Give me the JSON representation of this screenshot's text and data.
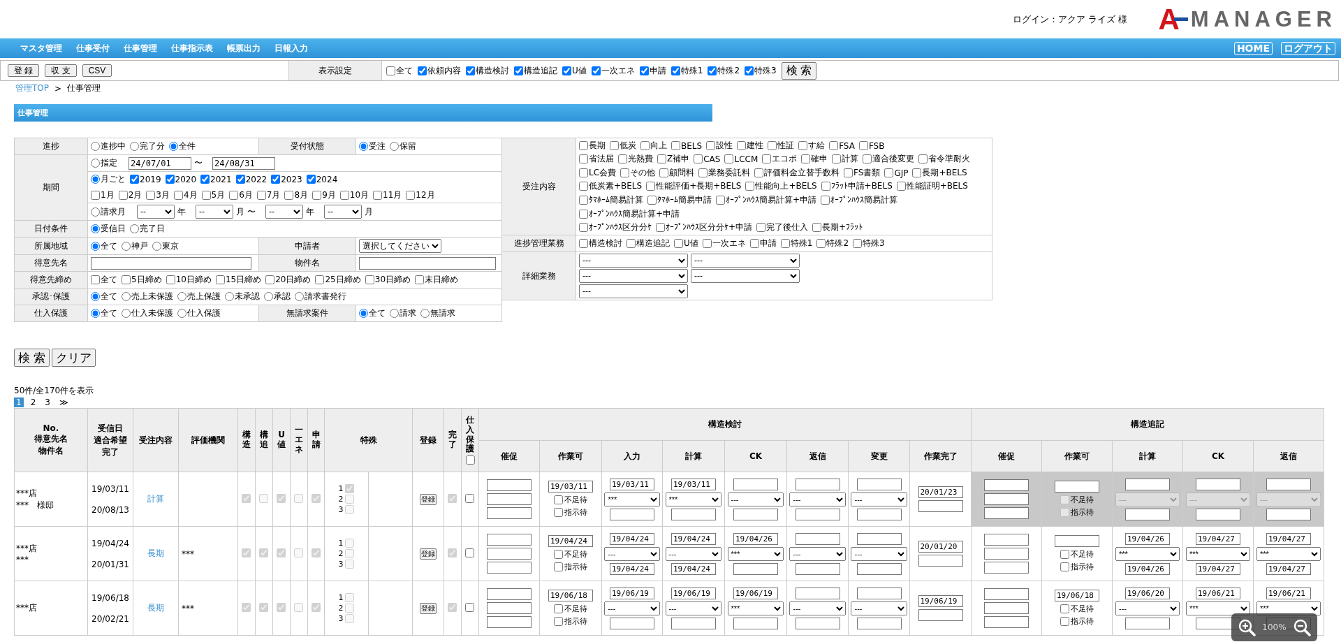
{
  "header": {
    "login": "ログイン：アクア ライズ 様",
    "logo": {
      "mark": "A",
      "name": "MANAGER"
    }
  },
  "nav": {
    "items": [
      "マスタ管理",
      "仕事受付",
      "仕事管理",
      "仕事指示表",
      "帳票出力",
      "日報入力"
    ],
    "buttons": [
      "HOME",
      "ログアウト"
    ]
  },
  "toolbar": {
    "buttons": [
      "登 録",
      "収 支",
      "CSV"
    ],
    "display_label": "表示設定",
    "display_options": [
      {
        "kind": "checkbox",
        "label": "全て",
        "checked": false
      },
      {
        "kind": "checkbox",
        "label": "依頼内容",
        "checked": true
      },
      {
        "kind": "checkbox",
        "label": "構造検討",
        "checked": true
      },
      {
        "kind": "checkbox",
        "label": "構造追記",
        "checked": true
      },
      {
        "kind": "checkbox",
        "label": "U値",
        "checked": true
      },
      {
        "kind": "checkbox",
        "label": "一次エネ",
        "checked": true
      },
      {
        "kind": "checkbox",
        "label": "申請",
        "checked": true
      },
      {
        "kind": "checkbox",
        "label": "特殊1",
        "checked": true
      },
      {
        "kind": "checkbox",
        "label": "特殊2",
        "checked": true
      },
      {
        "kind": "checkbox",
        "label": "特殊3",
        "checked": true
      }
    ],
    "search_button": "検 索"
  },
  "breadcrumb": {
    "link": "管理TOP",
    "separator": ">",
    "current": "仕事管理"
  },
  "section_title": "仕事管理",
  "filter_left": {
    "rows": [
      {
        "fields": [
          {
            "label": "進捗",
            "lines": [
              [
                {
                  "kind": "radio",
                  "label": "進捗中",
                  "selected": false
                },
                {
                  "kind": "radio",
                  "label": "完了分",
                  "selected": false
                },
                {
                  "kind": "radio",
                  "label": "全件",
                  "selected": true
                }
              ]
            ]
          },
          {
            "label": "受付状態",
            "lines": [
              [
                {
                  "kind": "radio",
                  "label": "受注",
                  "selected": true
                },
                {
                  "kind": "radio",
                  "label": "保留",
                  "selected": false
                }
              ]
            ]
          }
        ]
      },
      {
        "fields": [
          {
            "label": "期間",
            "lines": [
              [
                {
                  "kind": "radio",
                  "label": "指定",
                  "selected": false
                },
                {
                  "kind": "date",
                  "value": "24/07/01"
                },
                {
                  "kind": "text",
                  "text": "〜"
                },
                {
                  "kind": "date",
                  "value": "24/08/31"
                }
              ],
              [
                {
                  "kind": "radio",
                  "label": "月ごと",
                  "selected": true
                },
                {
                  "kind": "checkbox",
                  "label": "2019",
                  "checked": true
                },
                {
                  "kind": "checkbox",
                  "label": "2020",
                  "checked": true
                },
                {
                  "kind": "checkbox",
                  "label": "2021",
                  "checked": true
                },
                {
                  "kind": "checkbox",
                  "label": "2022",
                  "checked": true
                },
                {
                  "kind": "checkbox",
                  "label": "2023",
                  "checked": true
                },
                {
                  "kind": "checkbox",
                  "label": "2024",
                  "checked": true
                },
                {
                  "kind": "break"
                },
                {
                  "kind": "checkbox",
                  "label": "1月",
                  "checked": false
                },
                {
                  "kind": "checkbox",
                  "label": "2月",
                  "checked": false
                },
                {
                  "kind": "checkbox",
                  "label": "3月",
                  "checked": false
                },
                {
                  "kind": "checkbox",
                  "label": "4月",
                  "checked": false
                },
                {
                  "kind": "checkbox",
                  "label": "5月",
                  "checked": false
                },
                {
                  "kind": "checkbox",
                  "label": "6月",
                  "checked": false
                },
                {
                  "kind": "checkbox",
                  "label": "7月",
                  "checked": false
                },
                {
                  "kind": "checkbox",
                  "label": "8月",
                  "checked": false
                },
                {
                  "kind": "checkbox",
                  "label": "9月",
                  "checked": false
                },
                {
                  "kind": "checkbox",
                  "label": "10月",
                  "checked": false
                },
                {
                  "kind": "checkbox",
                  "label": "11月",
                  "checked": false
                },
                {
                  "kind": "checkbox",
                  "label": "12月",
                  "checked": false
                }
              ],
              [
                {
                  "kind": "radio",
                  "label": "請求月",
                  "selected": false
                },
                {
                  "kind": "period-select",
                  "value": "--"
                },
                {
                  "kind": "text",
                  "text": "年"
                },
                {
                  "kind": "period-select",
                  "value": "--"
                },
                {
                  "kind": "text",
                  "text": "月"
                },
                {
                  "kind": "text",
                  "text": "〜"
                },
                {
                  "kind": "period-select",
                  "value": "--"
                },
                {
                  "kind": "text",
                  "text": "年"
                },
                {
                  "kind": "period-select",
                  "value": "--"
                },
                {
                  "kind": "text",
                  "text": "月"
                }
              ]
            ]
          }
        ]
      },
      {
        "fields": [
          {
            "label": "日付条件",
            "lines": [
              [
                {
                  "kind": "radio",
                  "label": "受信日",
                  "selected": true
                },
                {
                  "kind": "radio",
                  "label": "完了日",
                  "selected": false
                }
              ]
            ]
          }
        ]
      },
      {
        "fields": [
          {
            "label": "所属地域",
            "lines": [
              [
                {
                  "kind": "radio",
                  "label": "全て",
                  "selected": true
                },
                {
                  "kind": "radio",
                  "label": "神戸",
                  "selected": false
                },
                {
                  "kind": "radio",
                  "label": "東京",
                  "selected": false
                }
              ]
            ]
          },
          {
            "label": "申請者",
            "lines": [
              [
                {
                  "kind": "select",
                  "value": "選択してください"
                }
              ]
            ]
          }
        ]
      },
      {
        "fields": [
          {
            "label": "得意先名",
            "lines": [
              [
                {
                  "kind": "input"
                }
              ]
            ]
          },
          {
            "label": "物件名",
            "lines": [
              [
                {
                  "kind": "input"
                }
              ]
            ]
          }
        ]
      },
      {
        "fields": [
          {
            "label": "得意先締め",
            "lines": [
              [
                {
                  "kind": "checkbox",
                  "label": "全て",
                  "checked": false
                },
                {
                  "kind": "checkbox",
                  "label": "5日締め",
                  "checked": false
                },
                {
                  "kind": "checkbox",
                  "label": "10日締め",
                  "checked": false
                },
                {
                  "kind": "checkbox",
                  "label": "15日締め",
                  "checked": false
                },
                {
                  "kind": "checkbox",
                  "label": "20日締め",
                  "checked": false
                },
                {
                  "kind": "checkbox",
                  "label": "25日締め",
                  "checked": false
                },
                {
                  "kind": "checkbox",
                  "label": "30日締め",
                  "checked": false
                },
                {
                  "kind": "checkbox",
                  "label": "末日締め",
                  "checked": false
                }
              ]
            ]
          }
        ]
      },
      {
        "fields": [
          {
            "label": "承認･保護",
            "lines": [
              [
                {
                  "kind": "radio",
                  "label": "全て",
                  "selected": true
                },
                {
                  "kind": "radio",
                  "label": "売上未保護",
                  "selected": false
                },
                {
                  "kind": "radio",
                  "label": "売上保護",
                  "selected": false
                },
                {
                  "kind": "radio",
                  "label": "未承認",
                  "selected": false
                },
                {
                  "kind": "radio",
                  "label": "承認",
                  "selected": false
                },
                {
                  "kind": "radio",
                  "label": "請求書発行",
                  "selected": false
                }
              ]
            ]
          }
        ]
      },
      {
        "fields": [
          {
            "label": "仕入保護",
            "lines": [
              [
                {
                  "kind": "radio",
                  "label": "全て",
                  "selected": true
                },
                {
                  "kind": "radio",
                  "label": "仕入未保護",
                  "selected": false
                },
                {
                  "kind": "radio",
                  "label": "仕入保護",
                  "selected": false
                }
              ]
            ]
          },
          {
            "label": "無請求案件",
            "lines": [
              [
                {
                  "kind": "radio",
                  "label": "全て",
                  "selected": true
                },
                {
                  "kind": "radio",
                  "label": "請求",
                  "selected": false
                },
                {
                  "kind": "radio",
                  "label": "無請求",
                  "selected": false
                }
              ]
            ]
          }
        ]
      }
    ]
  },
  "filter_right": {
    "rows": [
      {
        "fields": [
          {
            "label": "受注内容",
            "lines": [
              [
                {
                  "kind": "checkbox",
                  "label": "長期",
                  "checked": false
                },
                {
                  "kind": "checkbox",
                  "label": "低炭",
                  "checked": false
                },
                {
                  "kind": "checkbox",
                  "label": "向上",
                  "checked": false
                },
                {
                  "kind": "checkbox",
                  "label": "BELS",
                  "checked": false
                },
                {
                  "kind": "checkbox",
                  "label": "設性",
                  "checked": false
                },
                {
                  "kind": "checkbox",
                  "label": "建性",
                  "checked": false
                },
                {
                  "kind": "checkbox",
                  "label": "性証",
                  "checked": false
                },
                {
                  "kind": "checkbox",
                  "label": "す給",
                  "checked": false
                },
                {
                  "kind": "checkbox",
                  "label": "FSA",
                  "checked": false
                },
                {
                  "kind": "checkbox",
                  "label": "FSB",
                  "checked": false
                }
              ],
              [
                {
                  "kind": "checkbox",
                  "label": "省法届",
                  "checked": false
                },
                {
                  "kind": "checkbox",
                  "label": "光熱費",
                  "checked": false
                },
                {
                  "kind": "checkbox",
                  "label": "Z補申",
                  "checked": false
                },
                {
                  "kind": "checkbox",
                  "label": "CAS",
                  "checked": false
                },
                {
                  "kind": "checkbox",
                  "label": "LCCM",
                  "checked": false
                },
                {
                  "kind": "checkbox",
                  "label": "エコポ",
                  "checked": false
                },
                {
                  "kind": "checkbox",
                  "label": "確申",
                  "checked": false
                },
                {
                  "kind": "checkbox",
                  "label": "計算",
                  "checked": false
                },
                {
                  "kind": "checkbox",
                  "label": "適合後変更",
                  "checked": false
                },
                {
                  "kind": "checkbox",
                  "label": "省令準耐火",
                  "checked": false
                },
                {
                  "kind": "checkbox",
                  "label": "LC会費",
                  "checked": false
                },
                {
                  "kind": "checkbox",
                  "label": "その他",
                  "checked": false
                },
                {
                  "kind": "checkbox",
                  "label": "顧問料",
                  "checked": false
                },
                {
                  "kind": "checkbox",
                  "label": "業務委託料",
                  "checked": false
                },
                {
                  "kind": "checkbox",
                  "label": "評価料金立替手数料",
                  "checked": false
                },
                {
                  "kind": "checkbox",
                  "label": "FS書類",
                  "checked": false
                },
                {
                  "kind": "checkbox",
                  "label": "GJP",
                  "checked": false
                },
                {
                  "kind": "checkbox",
                  "label": "長期+BELS",
                  "checked": false
                }
              ],
              [
                {
                  "kind": "checkbox",
                  "label": "低炭素+BELS",
                  "checked": false
                },
                {
                  "kind": "checkbox",
                  "label": "性能評価+長期+BELS",
                  "checked": false
                },
                {
                  "kind": "checkbox",
                  "label": "性能向上+BELS",
                  "checked": false
                },
                {
                  "kind": "checkbox",
                  "label": "ﾌﾗｯﾄ申請+BELS",
                  "checked": false
                },
                {
                  "kind": "checkbox",
                  "label": "性能証明+BELS",
                  "checked": false
                },
                {
                  "kind": "checkbox",
                  "label": "ﾀﾏﾎｰﾑ簡易計算",
                  "checked": false
                },
                {
                  "kind": "checkbox",
                  "label": "ﾀﾏﾎｰﾑ簡易申請",
                  "checked": false
                },
                {
                  "kind": "checkbox",
                  "label": "ｵｰﾌﾟﾝﾊｳｽ簡易計算+申請",
                  "checked": false
                },
                {
                  "kind": "checkbox",
                  "label": "ｵｰﾌﾟﾝﾊｳｽ簡易計算",
                  "checked": false
                },
                {
                  "kind": "checkbox",
                  "label": "ｵｰﾌﾟﾝﾊｳｽ簡易計算+申請",
                  "checked": false
                }
              ],
              [
                {
                  "kind": "checkbox",
                  "label": "ｵｰﾌﾟﾝﾊｳｽ区分分ｹ",
                  "checked": false
                },
                {
                  "kind": "checkbox",
                  "label": "ｵｰﾌﾟﾝﾊｳｽ区分分ｹ+申請",
                  "checked": false
                },
                {
                  "kind": "checkbox",
                  "label": "完了後仕入",
                  "checked": false
                },
                {
                  "kind": "checkbox",
                  "label": "長期+ﾌﾗｯﾄ",
                  "checked": false
                }
              ]
            ]
          }
        ]
      },
      {
        "fields": [
          {
            "label": "進捗管理業務",
            "lines": [
              [
                {
                  "kind": "checkbox",
                  "label": "構造検討",
                  "checked": false
                },
                {
                  "kind": "checkbox",
                  "label": "構造追記",
                  "checked": false
                },
                {
                  "kind": "checkbox",
                  "label": "U値",
                  "checked": false
                },
                {
                  "kind": "checkbox",
                  "label": "一次エネ",
                  "checked": false
                },
                {
                  "kind": "checkbox",
                  "label": "申請",
                  "checked": false
                },
                {
                  "kind": "checkbox",
                  "label": "特殊1",
                  "checked": false
                },
                {
                  "kind": "checkbox",
                  "label": "特殊2",
                  "checked": false
                },
                {
                  "kind": "checkbox",
                  "label": "特殊3",
                  "checked": false
                }
              ]
            ]
          }
        ]
      },
      {
        "fields": [
          {
            "label": "詳細業務",
            "lines": [
              [
                {
                  "kind": "task-select",
                  "value": "---"
                },
                {
                  "kind": "task-select",
                  "value": "---"
                }
              ],
              [
                {
                  "kind": "task-select",
                  "value": "---"
                },
                {
                  "kind": "task-select",
                  "value": "---"
                }
              ],
              [
                {
                  "kind": "task-select",
                  "value": "---"
                }
              ]
            ]
          }
        ]
      }
    ]
  },
  "actions": [
    "検 索",
    "クリア"
  ],
  "result_count": "50件/全170件を表示",
  "pager": [
    {
      "label": "1",
      "selected": true
    },
    {
      "label": "2",
      "selected": false
    },
    {
      "label": "3",
      "selected": false
    },
    {
      "label": "≫",
      "selected": false
    }
  ],
  "table": {
    "columns": [
      {
        "kind": "multi",
        "lines": [
          "No.",
          "得意先名",
          "物件名"
        ]
      },
      {
        "kind": "multi",
        "lines": [
          "受信日",
          "適合希望",
          "完了"
        ]
      },
      {
        "kind": "plain",
        "text": "受注内容"
      },
      {
        "kind": "plain",
        "text": "評価機関"
      },
      {
        "kind": "vertical",
        "text": "構造"
      },
      {
        "kind": "vertical",
        "text": "構追"
      },
      {
        "kind": "vertical",
        "text": "U値"
      },
      {
        "kind": "vertical",
        "text": "一エネ"
      },
      {
        "kind": "vertical",
        "text": "申請"
      },
      {
        "kind": "special",
        "text": "特殊"
      },
      {
        "kind": "plain",
        "text": "登録"
      },
      {
        "kind": "vertical",
        "text": "完了"
      },
      {
        "kind": "vertical-check",
        "text": "仕入保護",
        "checked": false
      },
      {
        "kind": "group",
        "text": "構造検討",
        "columns": [
          "催促",
          "作業可",
          "入力",
          "計算",
          "CK",
          "返信",
          "変更",
          "作業完了"
        ]
      },
      {
        "kind": "group",
        "text": "構造追記",
        "columns": [
          "催促",
          "作業可",
          "計算",
          "CK",
          "返信"
        ]
      }
    ],
    "rows": [
      {
        "customer": "***店",
        "property": "***　様邸",
        "received": "19/03/11",
        "completed": "20/08/13",
        "order": "計算",
        "flags": [
          {
            "checked": true,
            "disabled": true
          },
          {
            "checked": false,
            "disabled": true
          },
          {
            "checked": true,
            "disabled": true
          },
          {
            "checked": false,
            "disabled": true
          },
          {
            "checked": true,
            "disabled": true
          }
        ],
        "specials": [
          {
            "label": "1",
            "checked": true,
            "disabled": true
          },
          {
            "label": "2",
            "checked": false,
            "disabled": true
          },
          {
            "label": "3",
            "checked": false,
            "disabled": true
          }
        ],
        "register": "登録",
        "done": {
          "checked": true,
          "disabled": true
        },
        "purchase": {
          "checked": false,
          "disabled": false
        },
        "groups": [
          {
            "disabled": false,
            "cells": [
              {
                "kind": "reminder"
              },
              {
                "kind": "permit",
                "value": "19/03/11",
                "waits": [
                  {
                    "label": "不足待",
                    "checked": false
                  },
                  {
                    "label": "指示待",
                    "checked": false
                  }
                ]
              },
              {
                "kind": "step",
                "start": "19/03/11",
                "status": "***"
              },
              {
                "kind": "step",
                "start": "19/03/11",
                "status": "***"
              },
              {
                "kind": "step",
                "status": "---"
              },
              {
                "kind": "step",
                "status": "---"
              },
              {
                "kind": "step",
                "status": "---"
              },
              {
                "kind": "finish",
                "date": "20/01/23"
              }
            ]
          },
          {
            "disabled": true,
            "cells": [
              {
                "kind": "reminder"
              },
              {
                "kind": "permit",
                "waits": [
                  {
                    "label": "不足待",
                    "checked": false
                  },
                  {
                    "label": "指示待",
                    "checked": false
                  }
                ]
              },
              {
                "kind": "step",
                "status": "---"
              },
              {
                "kind": "step",
                "status": "---"
              },
              {
                "kind": "step",
                "status": "---"
              }
            ]
          }
        ]
      },
      {
        "customer": "***店",
        "property": "***",
        "received": "19/04/24",
        "completed": "20/01/31",
        "order": "長期",
        "agency": "***",
        "flags": [
          {
            "checked": true,
            "disabled": true
          },
          {
            "checked": true,
            "disabled": true
          },
          {
            "checked": true,
            "disabled": true
          },
          {
            "checked": false,
            "disabled": true
          },
          {
            "checked": true,
            "disabled": true
          }
        ],
        "specials": [
          {
            "label": "1",
            "checked": false,
            "disabled": true
          },
          {
            "label": "2",
            "checked": false,
            "disabled": true
          },
          {
            "label": "3",
            "checked": false,
            "disabled": true
          }
        ],
        "register": "登録",
        "done": {
          "checked": true,
          "disabled": true
        },
        "purchase": {
          "checked": false,
          "disabled": false
        },
        "groups": [
          {
            "disabled": false,
            "cells": [
              {
                "kind": "reminder"
              },
              {
                "kind": "permit",
                "value": "19/04/24",
                "waits": [
                  {
                    "label": "不足待",
                    "checked": false
                  },
                  {
                    "label": "指示待",
                    "checked": false
                  }
                ]
              },
              {
                "kind": "step",
                "start": "19/04/24",
                "status": "---",
                "end": "19/04/24"
              },
              {
                "kind": "step",
                "start": "19/04/24",
                "status": "---",
                "end": "19/04/24"
              },
              {
                "kind": "step",
                "start": "19/04/26",
                "status": "***"
              },
              {
                "kind": "step",
                "status": "---"
              },
              {
                "kind": "step",
                "status": "---"
              },
              {
                "kind": "finish",
                "date": "20/01/20"
              }
            ]
          },
          {
            "disabled": false,
            "cells": [
              {
                "kind": "reminder"
              },
              {
                "kind": "permit",
                "waits": [
                  {
                    "label": "不足待",
                    "checked": false
                  },
                  {
                    "label": "指示待",
                    "checked": false
                  }
                ]
              },
              {
                "kind": "step",
                "start": "19/04/26",
                "status": "***",
                "end": "19/04/26"
              },
              {
                "kind": "step",
                "start": "19/04/27",
                "status": "***",
                "end": "19/04/27"
              },
              {
                "kind": "step",
                "start": "19/04/27",
                "status": "***",
                "end": "19/04/27"
              }
            ]
          }
        ]
      },
      {
        "customer": "***店",
        "received": "19/06/18",
        "completed": "20/02/21",
        "order": "長期",
        "agency": "***",
        "flags": [
          {
            "checked": true,
            "disabled": true
          },
          {
            "checked": true,
            "disabled": true
          },
          {
            "checked": true,
            "disabled": true
          },
          {
            "checked": false,
            "disabled": true
          },
          {
            "checked": true,
            "disabled": true
          }
        ],
        "specials": [
          {
            "label": "1",
            "checked": false,
            "disabled": true
          },
          {
            "label": "2",
            "checked": false,
            "disabled": true
          },
          {
            "label": "3",
            "checked": false,
            "disabled": true
          }
        ],
        "register": "登録",
        "done": {
          "checked": true,
          "disabled": true
        },
        "purchase": {
          "checked": false,
          "disabled": false
        },
        "groups": [
          {
            "disabled": false,
            "cells": [
              {
                "kind": "reminder"
              },
              {
                "kind": "permit",
                "value": "19/06/18",
                "waits": [
                  {
                    "label": "不足待",
                    "checked": false
                  },
                  {
                    "label": "指示待",
                    "checked": false
                  }
                ]
              },
              {
                "kind": "step",
                "start": "19/06/19",
                "status": "---"
              },
              {
                "kind": "step",
                "start": "19/06/19",
                "status": "---"
              },
              {
                "kind": "step",
                "start": "19/06/19",
                "status": "***"
              },
              {
                "kind": "step",
                "status": "---"
              },
              {
                "kind": "step",
                "status": "---"
              },
              {
                "kind": "finish",
                "date": "19/06/19"
              }
            ]
          },
          {
            "disabled": false,
            "cells": [
              {
                "kind": "reminder"
              },
              {
                "kind": "permit",
                "value": "19/06/18",
                "waits": [
                  {
                    "label": "不足待",
                    "checked": false
                  },
                  {
                    "label": "指示待",
                    "checked": false
                  }
                ]
              },
              {
                "kind": "step",
                "start": "19/06/20",
                "status": "---"
              },
              {
                "kind": "step",
                "start": "19/06/21",
                "status": "***"
              },
              {
                "kind": "step",
                "start": "19/06/21",
                "status": "***"
              }
            ]
          }
        ]
      }
    ]
  },
  "zoom_overlay": {
    "text": "100%"
  }
}
